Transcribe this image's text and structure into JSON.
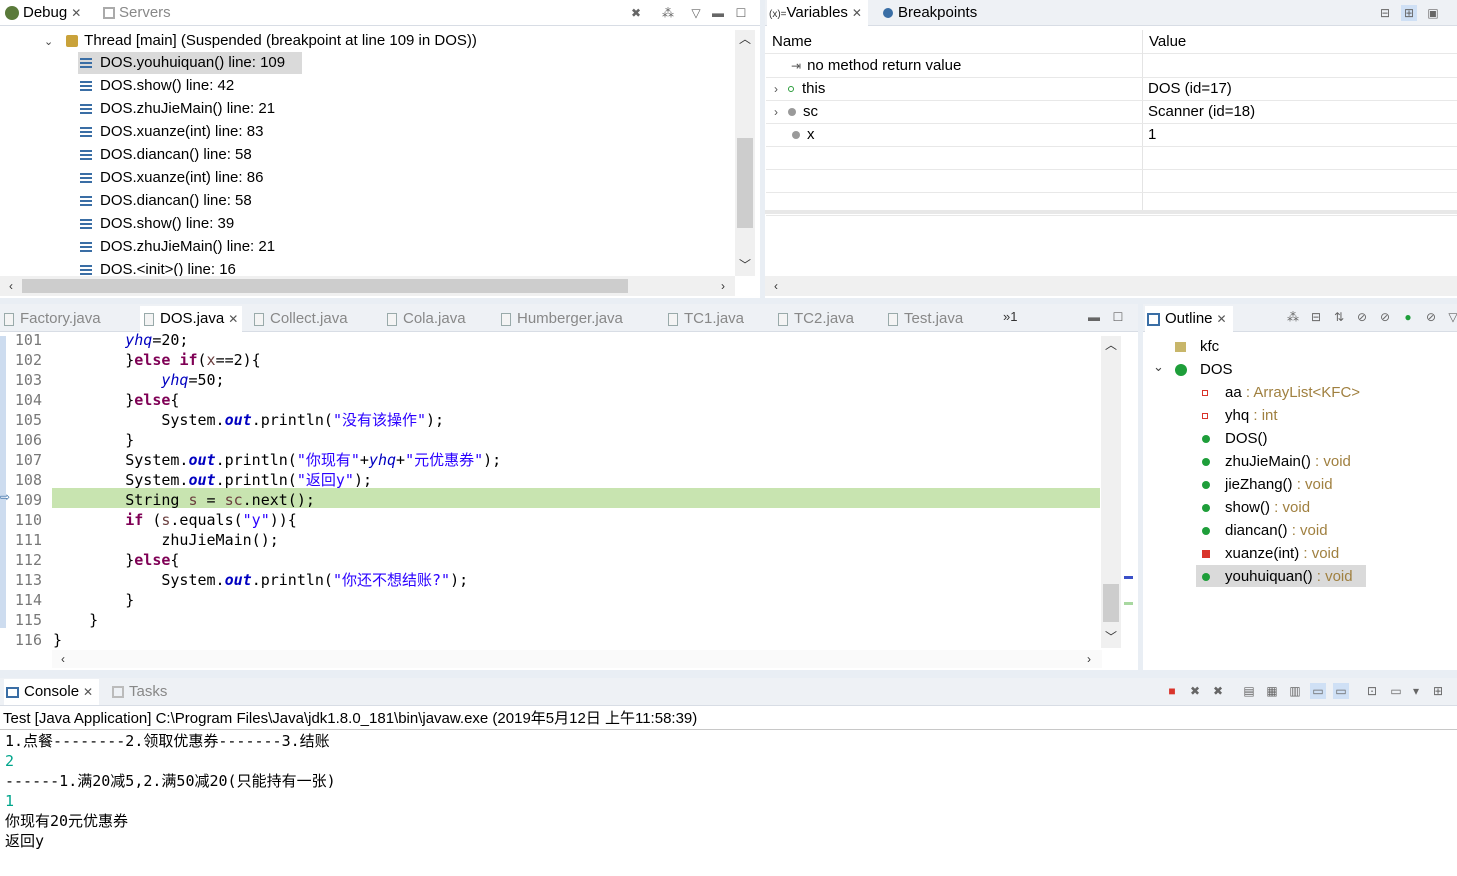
{
  "debug_view": {
    "tabs": [
      {
        "label": "Debug",
        "active": true
      },
      {
        "label": "Servers",
        "active": false
      }
    ],
    "thread_label": "Thread [main] (Suspended (breakpoint at line 109 in DOS))",
    "frames": [
      "DOS.youhuiquan() line: 109",
      "DOS.show() line: 42",
      "DOS.zhuJieMain() line: 21",
      "DOS.xuanze(int) line: 83",
      "DOS.diancan() line: 58",
      "DOS.xuanze(int) line: 86",
      "DOS.diancan() line: 58",
      "DOS.show() line: 39",
      "DOS.zhuJieMain() line: 21",
      "DOS.<init>() line: 16"
    ]
  },
  "variables_view": {
    "tabs": [
      {
        "label": "Variables",
        "prefix": "(x)=",
        "active": true
      },
      {
        "label": "Breakpoints",
        "active": false
      }
    ],
    "columns": {
      "name": "Name",
      "value": "Value"
    },
    "rows": [
      {
        "name": "no method return value",
        "value": ""
      },
      {
        "name": "this",
        "value": "DOS  (id=17)"
      },
      {
        "name": "sc",
        "value": "Scanner  (id=18)"
      },
      {
        "name": "x",
        "value": "1"
      }
    ]
  },
  "editor": {
    "tabs": [
      "Factory.java",
      "DOS.java",
      "Collect.java",
      "Cola.java",
      "Humberger.java",
      "TC1.java",
      "TC2.java",
      "Test.java"
    ],
    "active_tab": "DOS.java",
    "overflow_label": "»1",
    "lines": [
      {
        "num": "101",
        "text": "        yhq=20;"
      },
      {
        "num": "102",
        "text": "        }else if(x==2){"
      },
      {
        "num": "103",
        "text": "            yhq=50;"
      },
      {
        "num": "104",
        "text": "        }else{"
      },
      {
        "num": "105",
        "text": "            System.out.println(\"没有该操作\");"
      },
      {
        "num": "106",
        "text": "        }"
      },
      {
        "num": "107",
        "text": "        System.out.println(\"你现有\"+yhq+\"元优惠券\");"
      },
      {
        "num": "108",
        "text": "        System.out.println(\"返回y\");"
      },
      {
        "num": "109",
        "text": "        String s = sc.next();"
      },
      {
        "num": "110",
        "text": "        if (s.equals(\"y\")){"
      },
      {
        "num": "111",
        "text": "            zhuJieMain();"
      },
      {
        "num": "112",
        "text": "        }else{"
      },
      {
        "num": "113",
        "text": "            System.out.println(\"你还不想结账?\");"
      },
      {
        "num": "114",
        "text": "        }"
      },
      {
        "num": "115",
        "text": "    }"
      },
      {
        "num": "116",
        "text": "}"
      }
    ],
    "current_line": "109"
  },
  "outline": {
    "tab_label": "Outline",
    "items": [
      {
        "label": "kfc",
        "type": "",
        "kind": "package"
      },
      {
        "label": "DOS",
        "type": "",
        "kind": "class"
      },
      {
        "label": "aa",
        "type": " : ArrayList<KFC>",
        "kind": "private-field"
      },
      {
        "label": "yhq",
        "type": " : int",
        "kind": "private-field"
      },
      {
        "label": "DOS()",
        "type": "",
        "kind": "constructor"
      },
      {
        "label": "zhuJieMain()",
        "type": " : void",
        "kind": "public-method"
      },
      {
        "label": "jieZhang()",
        "type": " : void",
        "kind": "public-method"
      },
      {
        "label": "show()",
        "type": " : void",
        "kind": "public-method"
      },
      {
        "label": "diancan()",
        "type": " : void",
        "kind": "public-method"
      },
      {
        "label": "xuanze(int)",
        "type": " : void",
        "kind": "private-method"
      },
      {
        "label": "youhuiquan()",
        "type": " : void",
        "kind": "public-method"
      }
    ],
    "selected": "youhuiquan()"
  },
  "console": {
    "tabs": [
      {
        "label": "Console",
        "active": true
      },
      {
        "label": "Tasks",
        "active": false
      }
    ],
    "launch_label": "Test [Java Application] C:\\Program Files\\Java\\jdk1.8.0_181\\bin\\javaw.exe (2019年5月12日 上午11:58:39)",
    "lines": [
      {
        "text": "1.点餐--------2.领取优惠券-------3.结账",
        "input": false
      },
      {
        "text": "2",
        "input": true
      },
      {
        "text": "------1.满20减5,2.满50减20(只能持有一张)",
        "input": false
      },
      {
        "text": "1",
        "input": true
      },
      {
        "text": "你现有20元优惠券",
        "input": false
      },
      {
        "text": "返回y",
        "input": false
      }
    ]
  },
  "colors": {
    "accent": "#3a6ea5",
    "current_line": "#c8e4b0",
    "input_text": "#00a58b"
  }
}
